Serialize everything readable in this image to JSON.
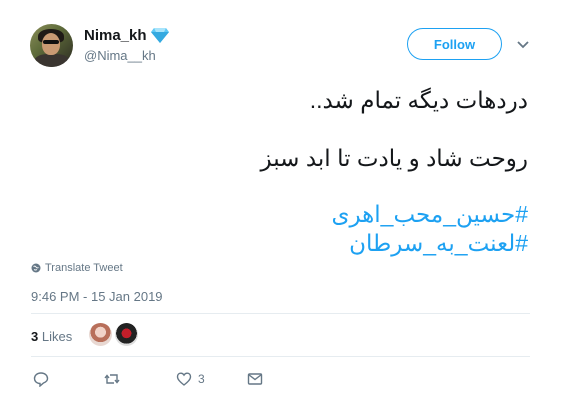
{
  "user": {
    "display_name": "Nima_kh",
    "handle": "@Nima__kh",
    "verified_emoji": "diamond-icon"
  },
  "header": {
    "follow_label": "Follow",
    "menu_icon": "chevron-down-icon"
  },
  "tweet": {
    "lines": [
      "دردهات دیگه تمام شد..",
      "روحت شاد و یادت تا ابد سبز"
    ],
    "hashtags": [
      "#حسین_محب_اهری",
      "#لعنت_به_سرطان"
    ]
  },
  "translate_label": "Translate Tweet",
  "timestamp": "9:46 PM - 15 Jan 2019",
  "likes": {
    "count": "3",
    "label": "Likes"
  },
  "actions": {
    "reply_count": "",
    "retweet_count": "",
    "like_count": "3",
    "dm_count": ""
  },
  "colors": {
    "accent": "#1da1f2",
    "muted": "#657786",
    "text": "#14171a",
    "divider": "#e6ecf0"
  }
}
